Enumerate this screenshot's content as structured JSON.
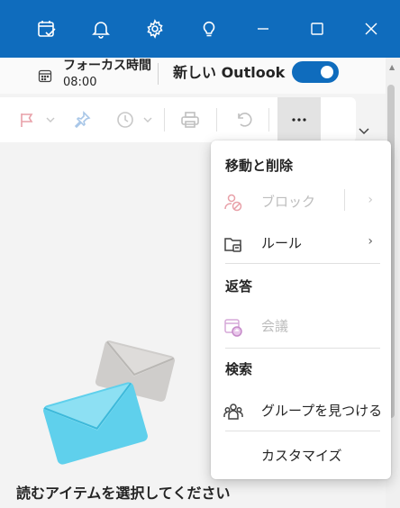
{
  "titlebar": {
    "icons": [
      "calendar-check-icon",
      "bell-icon",
      "gear-icon",
      "lightbulb-icon",
      "minimize-icon",
      "maximize-icon",
      "close-icon"
    ],
    "color": "#0f6cbd"
  },
  "focus": {
    "title": "フォーカス時間",
    "time": "08:00",
    "icon": "calendar-icon"
  },
  "new_outlook": {
    "label": "新しい Outlook",
    "toggle_on": true
  },
  "toolbar": {
    "icons": [
      "flag-icon",
      "chevron-down-icon",
      "pin-icon",
      "clock-icon",
      "chevron-down-icon",
      "print-icon",
      "undo-icon",
      "more-icon"
    ]
  },
  "menu": {
    "sections": [
      {
        "header": "移動と削除",
        "items": [
          {
            "label": "ブロック",
            "icon": "block-person-icon",
            "disabled": true,
            "submenu": true
          },
          {
            "label": "ルール",
            "icon": "folder-rules-icon",
            "disabled": false,
            "submenu": true
          }
        ]
      },
      {
        "header": "返答",
        "items": [
          {
            "label": "会議",
            "icon": "calendar-reply-icon",
            "disabled": true,
            "submenu": false
          }
        ]
      },
      {
        "header": "検索",
        "items": [
          {
            "label": "グループを見つける",
            "icon": "people-group-icon",
            "disabled": false,
            "submenu": false
          }
        ]
      }
    ],
    "customize": "カスタマイズ"
  },
  "reading_pane": {
    "empty_text": "読むアイテムを選択してください"
  }
}
